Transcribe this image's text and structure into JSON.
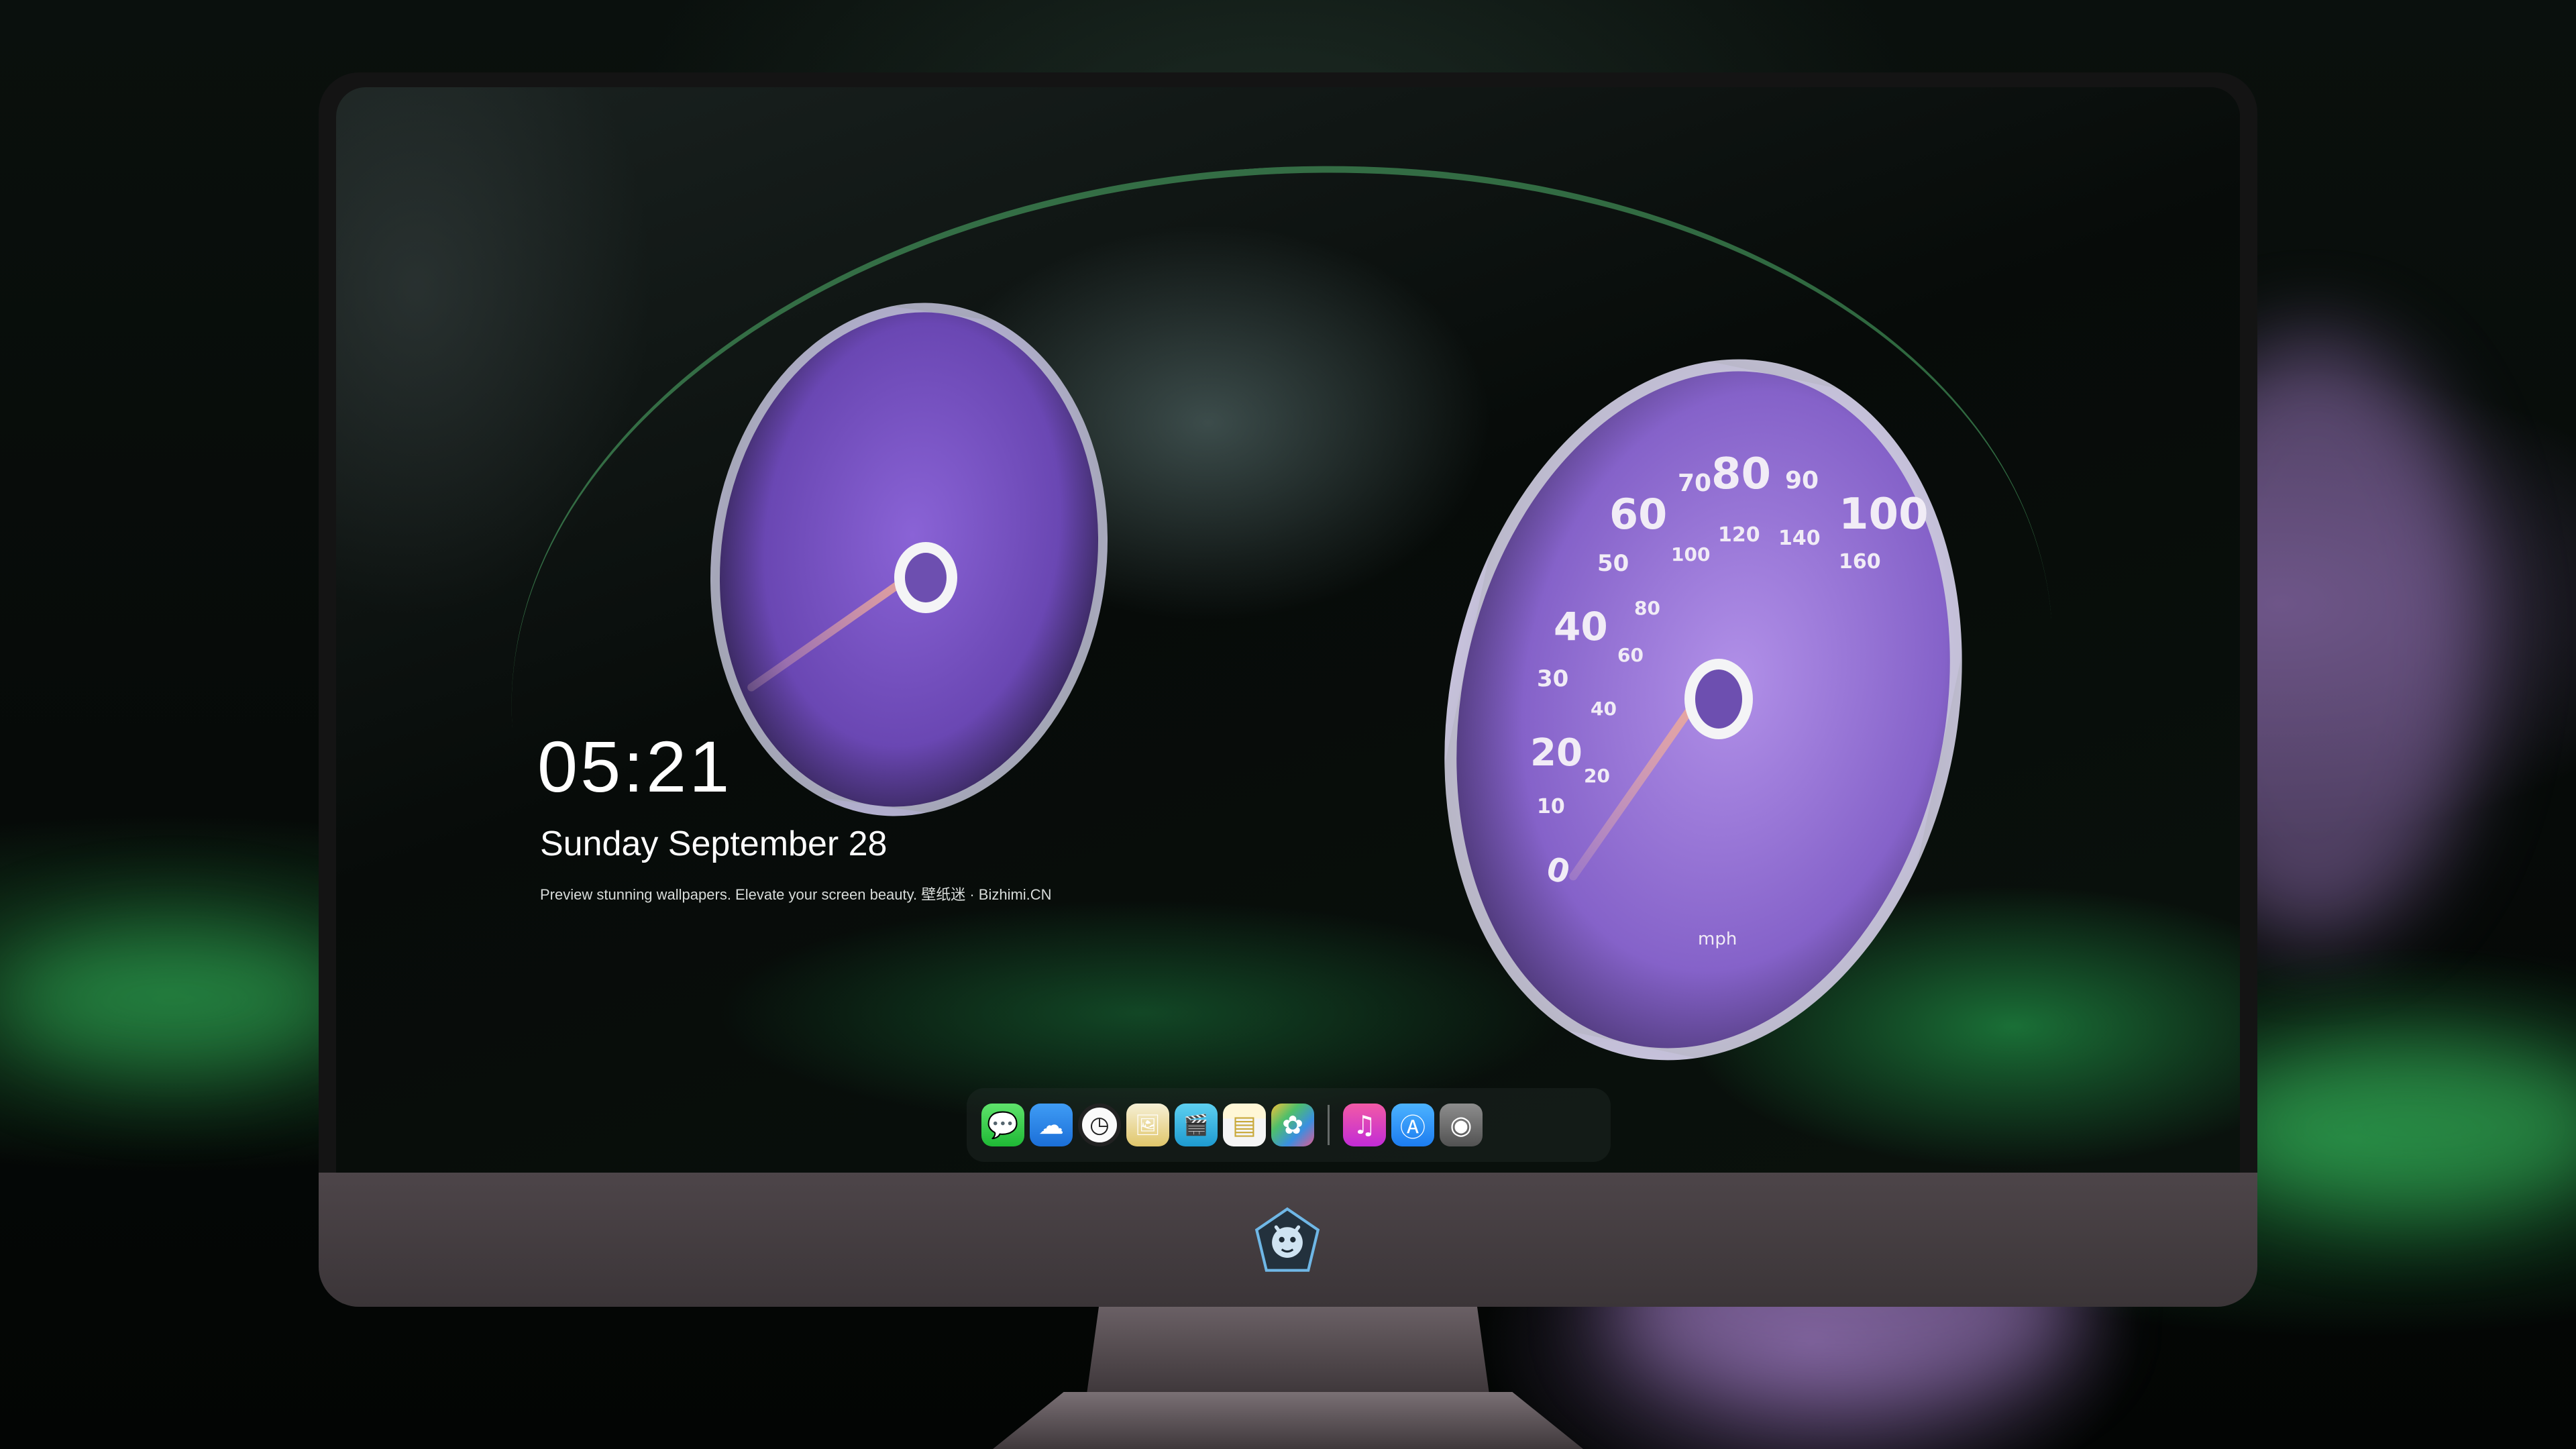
{
  "lockscreen": {
    "time": "05:21",
    "date": "Sunday September  28",
    "tagline": "Preview stunning wallpapers. Elevate your screen beauty. 壁纸迷 · Bizhimi.CN"
  },
  "speedometer": {
    "labels": [
      "0",
      "10",
      "20",
      "20",
      "30",
      "40",
      "40",
      "50",
      "60",
      "60",
      "70",
      "80",
      "80",
      "90",
      "100",
      "100",
      "120",
      "140",
      "160"
    ],
    "unit": "mph"
  },
  "dock": {
    "apps": [
      {
        "name": "messages-icon",
        "glyph": "💬"
      },
      {
        "name": "weather-icon",
        "glyph": "☁"
      },
      {
        "name": "clock-icon",
        "glyph": "◷"
      },
      {
        "name": "preview-icon",
        "glyph": "🖼"
      },
      {
        "name": "clips-icon",
        "glyph": "🎬"
      },
      {
        "name": "notes-icon",
        "glyph": "▤"
      },
      {
        "name": "photos-icon",
        "glyph": "✿"
      },
      {
        "name": "music-icon",
        "glyph": "♫"
      },
      {
        "name": "app-store-icon",
        "glyph": "Ⓐ"
      },
      {
        "name": "camera-icon",
        "glyph": "◉"
      }
    ]
  },
  "colors": {
    "gauge_purple": "#8a63d6",
    "trim_green": "#3fcf6e",
    "chin": "#4a4246"
  }
}
